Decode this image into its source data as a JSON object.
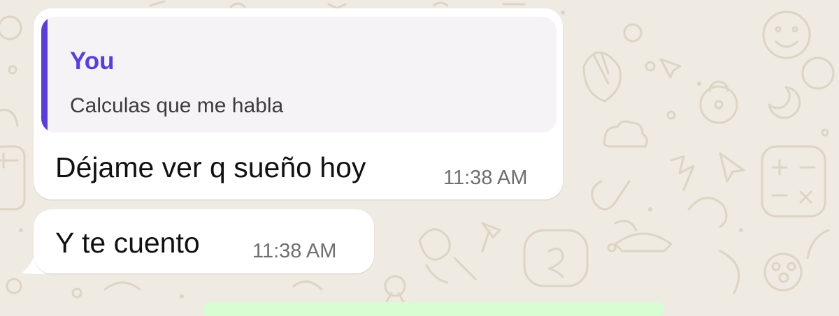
{
  "colors": {
    "chat_background": "#efeae2",
    "bubble_background": "#ffffff",
    "quote_background": "#f5f3f6",
    "quote_accent": "#5b3fd2",
    "quote_author": "#5a3fd6",
    "timestamp": "#6f6f6f",
    "outgoing_bubble": "#d9fdd3"
  },
  "messages": [
    {
      "reply": {
        "author": "You",
        "text": "Calculas que me habla"
      },
      "text": "Déjame ver q sueño hoy",
      "time": "11:38 AM"
    },
    {
      "text": "Y te cuento",
      "time": "11:38 AM"
    }
  ]
}
